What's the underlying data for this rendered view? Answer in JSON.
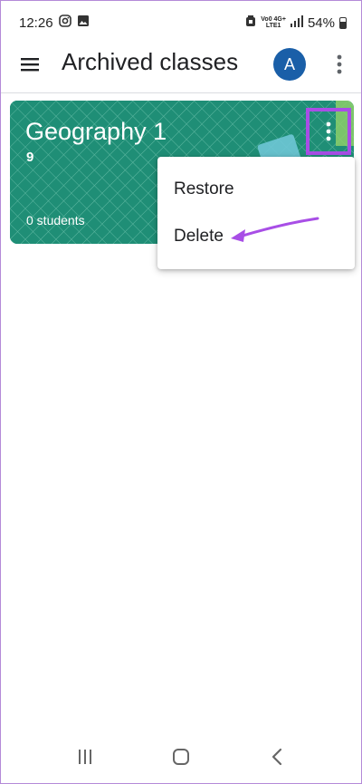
{
  "status_bar": {
    "time": "12:26",
    "network_top": "Vo0 4G+",
    "network_bottom": "LTE1",
    "battery_percent": "54%",
    "icons": [
      "instagram-icon",
      "gallery-icon",
      "alarm-icon",
      "signal-icon",
      "battery-icon"
    ]
  },
  "app_bar": {
    "title": "Archived classes",
    "avatar_letter": "A",
    "avatar_color": "#1a5fa8"
  },
  "class_card": {
    "title": "Geography 1",
    "section": "9",
    "students": "0 students",
    "color": "#1f8e76"
  },
  "menu": {
    "items": [
      {
        "label": "Restore"
      },
      {
        "label": "Delete"
      }
    ]
  },
  "highlight_color": "#a84ee6",
  "nav_bar": {
    "icons": [
      "recents-icon",
      "home-icon",
      "back-icon"
    ]
  }
}
